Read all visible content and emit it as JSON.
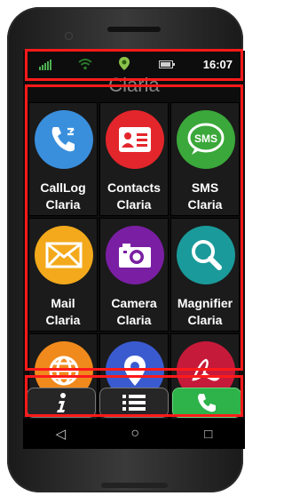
{
  "status_bar": {
    "time": "16:07"
  },
  "header": {
    "ghost_title": "Claria"
  },
  "apps": [
    {
      "label_line1": "CallLog",
      "label_line2": "Claria",
      "icon": "calllog-icon",
      "color": "#3a8fdd"
    },
    {
      "label_line1": "Contacts",
      "label_line2": "Claria",
      "icon": "contacts-icon",
      "color": "#e3262b"
    },
    {
      "label_line1": "SMS",
      "label_line2": "Claria",
      "icon": "sms-icon",
      "color": "#3aa83a"
    },
    {
      "label_line1": "Mail",
      "label_line2": "Claria",
      "icon": "mail-icon",
      "color": "#f3a91b"
    },
    {
      "label_line1": "Camera",
      "label_line2": "Claria",
      "icon": "camera-icon",
      "color": "#7a1fa3"
    },
    {
      "label_line1": "Magnifier",
      "label_line2": "Claria",
      "icon": "magnifier-icon",
      "color": "#1a9a9a"
    },
    {
      "label_line1": "",
      "label_line2": "",
      "icon": "globe-icon",
      "color": "#f08a1c"
    },
    {
      "label_line1": "",
      "label_line2": "",
      "icon": "location-icon",
      "color": "#3a5bd0"
    },
    {
      "label_line1": "",
      "label_line2": "",
      "icon": "pdf-icon",
      "color": "#c61a3a"
    }
  ],
  "bottom_bar": {
    "info_icon": "info-icon",
    "menu_icon": "list-menu-icon",
    "call_icon": "phone-icon"
  },
  "nav": {
    "back": "◁",
    "home": "○",
    "recents": "□"
  },
  "colors": {
    "highlight": "#ff1a1a",
    "call_green": "#2eb24a"
  }
}
